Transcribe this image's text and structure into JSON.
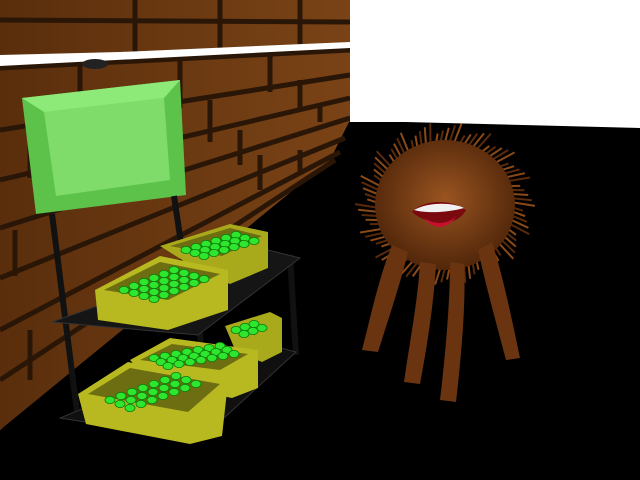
{
  "scene": {
    "sky_color": "#ffffff",
    "floor_color": "#000000",
    "wall_color": "#6b3a12",
    "wall_mortar_color": "#2a1606",
    "sign_color": "#7fdc6a",
    "sign_frame_color": "#5cc24a",
    "crate_color": "#b8b820",
    "fruit_color": "#2ee62e",
    "creature_fur_color": "#7a3e14",
    "creature_mouth_color": "#c8102e"
  },
  "objects": {
    "wall_icon": "brick-wall",
    "stand_icon": "market-stand",
    "sign_icon": "blank-sign",
    "crate_icon": "fruit-crate",
    "creature_icon": "furry-monster"
  }
}
